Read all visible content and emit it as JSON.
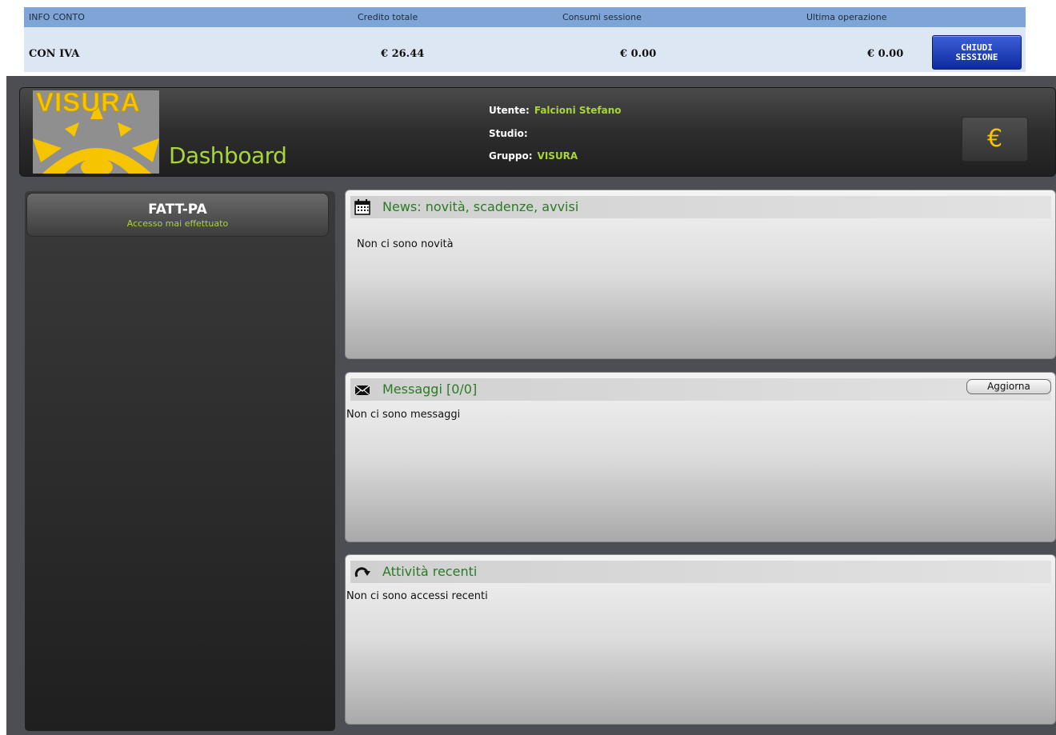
{
  "account": {
    "headers": [
      "INFO CONTO",
      "Credito totale",
      "Consumi sessione",
      "Ultima operazione"
    ],
    "row": {
      "label": "CON IVA",
      "credito": "€ 26.44",
      "consumi": "€ 0.00",
      "ultima": "€ 0.00"
    },
    "close_button": {
      "line1": "CHIUDI",
      "line2": "SESSIONE"
    }
  },
  "banner": {
    "logo_text": "VISURA",
    "title": "Dashboard",
    "user": {
      "label": "Utente:",
      "value": "Falcioni Stefano"
    },
    "studio": {
      "label": "Studio:",
      "value": ""
    },
    "group": {
      "label": "Gruppo:",
      "value": "VISURA"
    },
    "euro_button": "€"
  },
  "sidebar": {
    "app": {
      "name": "FATT-PA",
      "status": "Accesso mai effettuato"
    }
  },
  "panels": {
    "news": {
      "title": "News: novità, scadenze, avvisi",
      "body": "Non ci sono novità",
      "icon": "calendar-icon"
    },
    "messages": {
      "title": "Messaggi [0/0]",
      "body": "Non ci sono messaggi",
      "refresh_label": "Aggiorna",
      "icon": "envelope-icon"
    },
    "activity": {
      "title": "Attività recenti",
      "body": "Non ci sono accessi recenti",
      "icon": "refresh-arrow-icon"
    }
  },
  "colors": {
    "accent_green": "#a8d63a",
    "title_green": "#2a7b24",
    "logo_yellow": "#f6c400",
    "info_header": "#7ea5d6"
  }
}
